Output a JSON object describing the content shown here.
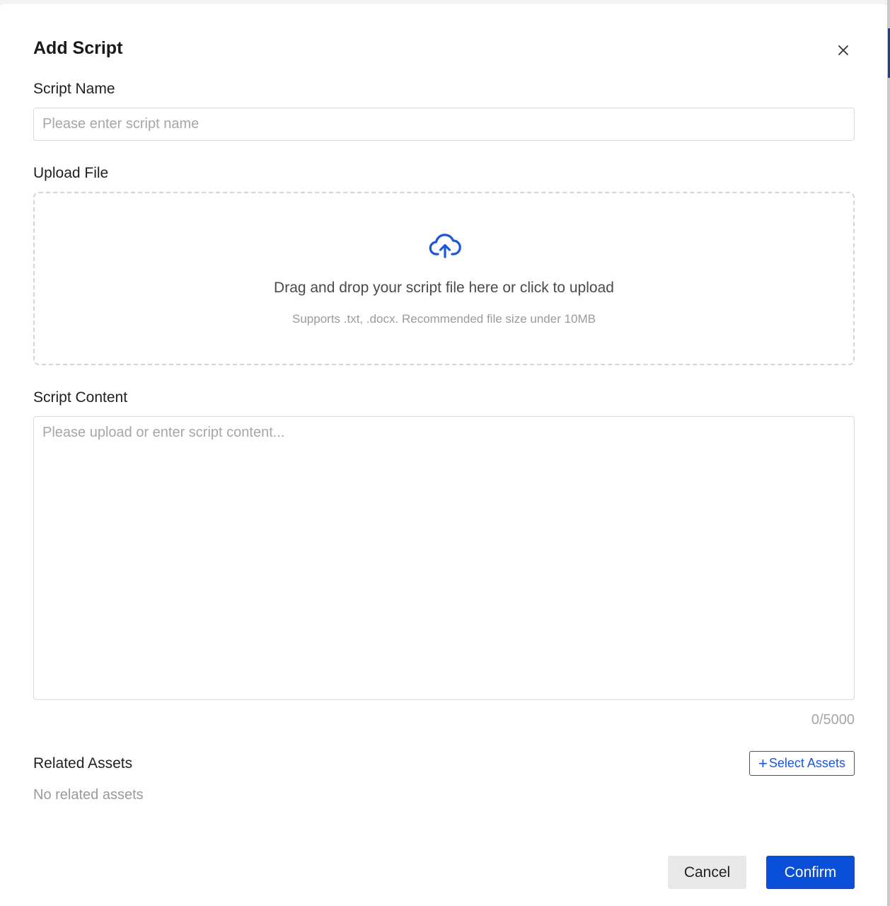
{
  "dialog": {
    "title": "Add Script",
    "close_icon": "close-icon"
  },
  "script_name": {
    "label": "Script Name",
    "value": "",
    "placeholder": "Please enter script name"
  },
  "upload": {
    "label": "Upload File",
    "icon": "cloud-upload-icon",
    "drop_text": "Drag and drop your script file here or click to upload",
    "hint": "Supports .txt, .docx. Recommended file size under 10MB"
  },
  "script_content": {
    "label": "Script Content",
    "value": "",
    "placeholder": "Please upload or enter script content...",
    "counter": "0/5000"
  },
  "related_assets": {
    "label": "Related Assets",
    "select_plus": "+",
    "select_label": "Select Assets",
    "empty_text": "No related assets"
  },
  "footer": {
    "cancel_label": "Cancel",
    "confirm_label": "Confirm"
  },
  "colors": {
    "accent": "#0a4fd8",
    "icon_blue": "#1a56db",
    "placeholder": "#a6a6a6",
    "border": "#d9d9d9"
  }
}
